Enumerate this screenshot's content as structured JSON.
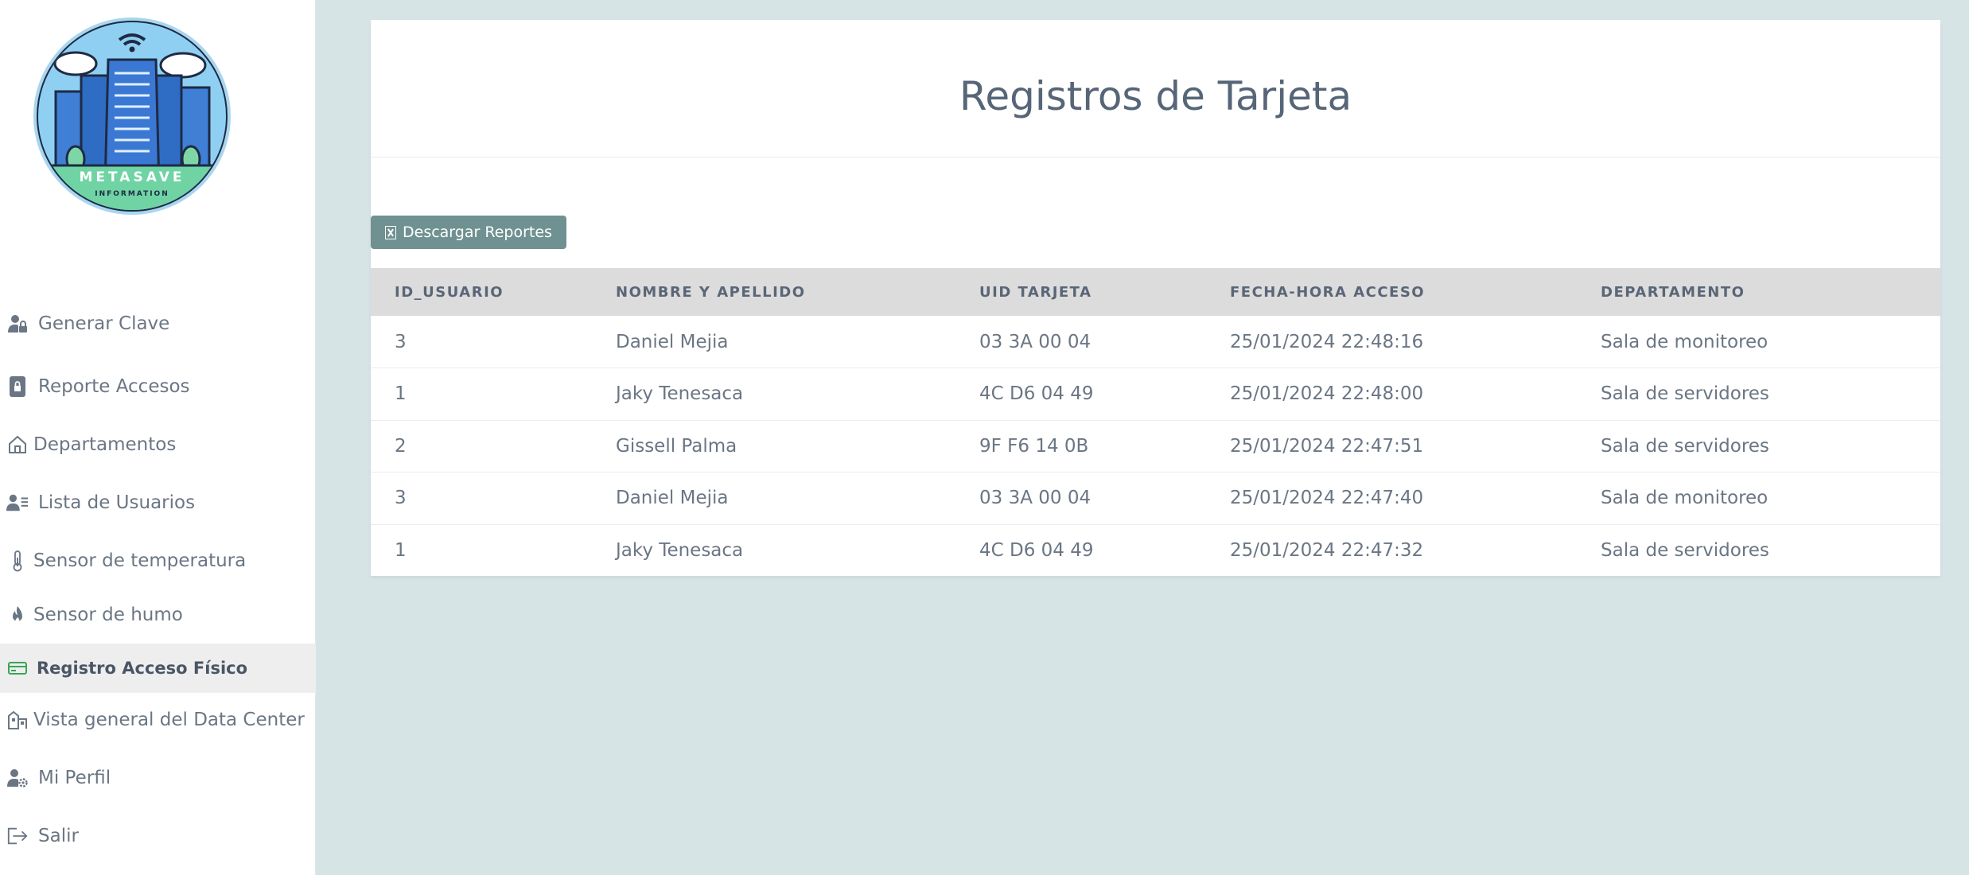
{
  "logo": {
    "text_top": "METASAVE",
    "text_bottom": "INFORMATION"
  },
  "sidebar": {
    "items": [
      {
        "label": "Generar Clave",
        "icon": "user-lock-icon"
      },
      {
        "label": "Reporte Accesos",
        "icon": "lock-icon"
      },
      {
        "label": "Departamentos",
        "icon": "house-icon"
      },
      {
        "label": "Lista de Usuarios",
        "icon": "user-list-icon"
      },
      {
        "label": "Sensor de temperatura",
        "icon": "thermometer-icon"
      },
      {
        "label": "Sensor de humo",
        "icon": "fire-icon"
      },
      {
        "label": "Registro Acceso Físico",
        "icon": "credit-card-icon",
        "active": true
      },
      {
        "label": "Vista general del Data Center",
        "icon": "buildings-icon"
      },
      {
        "label": "Mi Perfil",
        "icon": "user-gear-icon"
      },
      {
        "label": "Salir",
        "icon": "logout-icon"
      }
    ]
  },
  "main": {
    "title": "Registros de Tarjeta",
    "download_label": "Descargar Reportes",
    "download_icon": "excel-file-icon",
    "table": {
      "headers": [
        "ID_USUARIO",
        "NOMBRE Y APELLIDO",
        "UID TARJETA",
        "FECHA-HORA ACCESO",
        "DEPARTAMENTO"
      ],
      "rows": [
        [
          "3",
          "Daniel Mejia",
          "03 3A 00 04",
          "25/01/2024 22:48:16",
          "Sala de monitoreo"
        ],
        [
          "1",
          "Jaky Tenesaca",
          "4C D6 04 49",
          "25/01/2024 22:48:00",
          "Sala de servidores"
        ],
        [
          "2",
          "Gissell Palma",
          "9F F6 14 0B",
          "25/01/2024 22:47:51",
          "Sala de servidores"
        ],
        [
          "3",
          "Daniel Mejia",
          "03 3A 00 04",
          "25/01/2024 22:47:40",
          "Sala de monitoreo"
        ],
        [
          "1",
          "Jaky Tenesaca",
          "4C D6 04 49",
          "25/01/2024 22:47:32",
          "Sala de servidores"
        ]
      ]
    }
  },
  "colors": {
    "background": "#d6e4e5",
    "accent_button": "#6f9191",
    "active_nav_bg": "#eeeeee",
    "active_icon": "#3aa655",
    "header_row_bg": "#dcdcdc"
  }
}
